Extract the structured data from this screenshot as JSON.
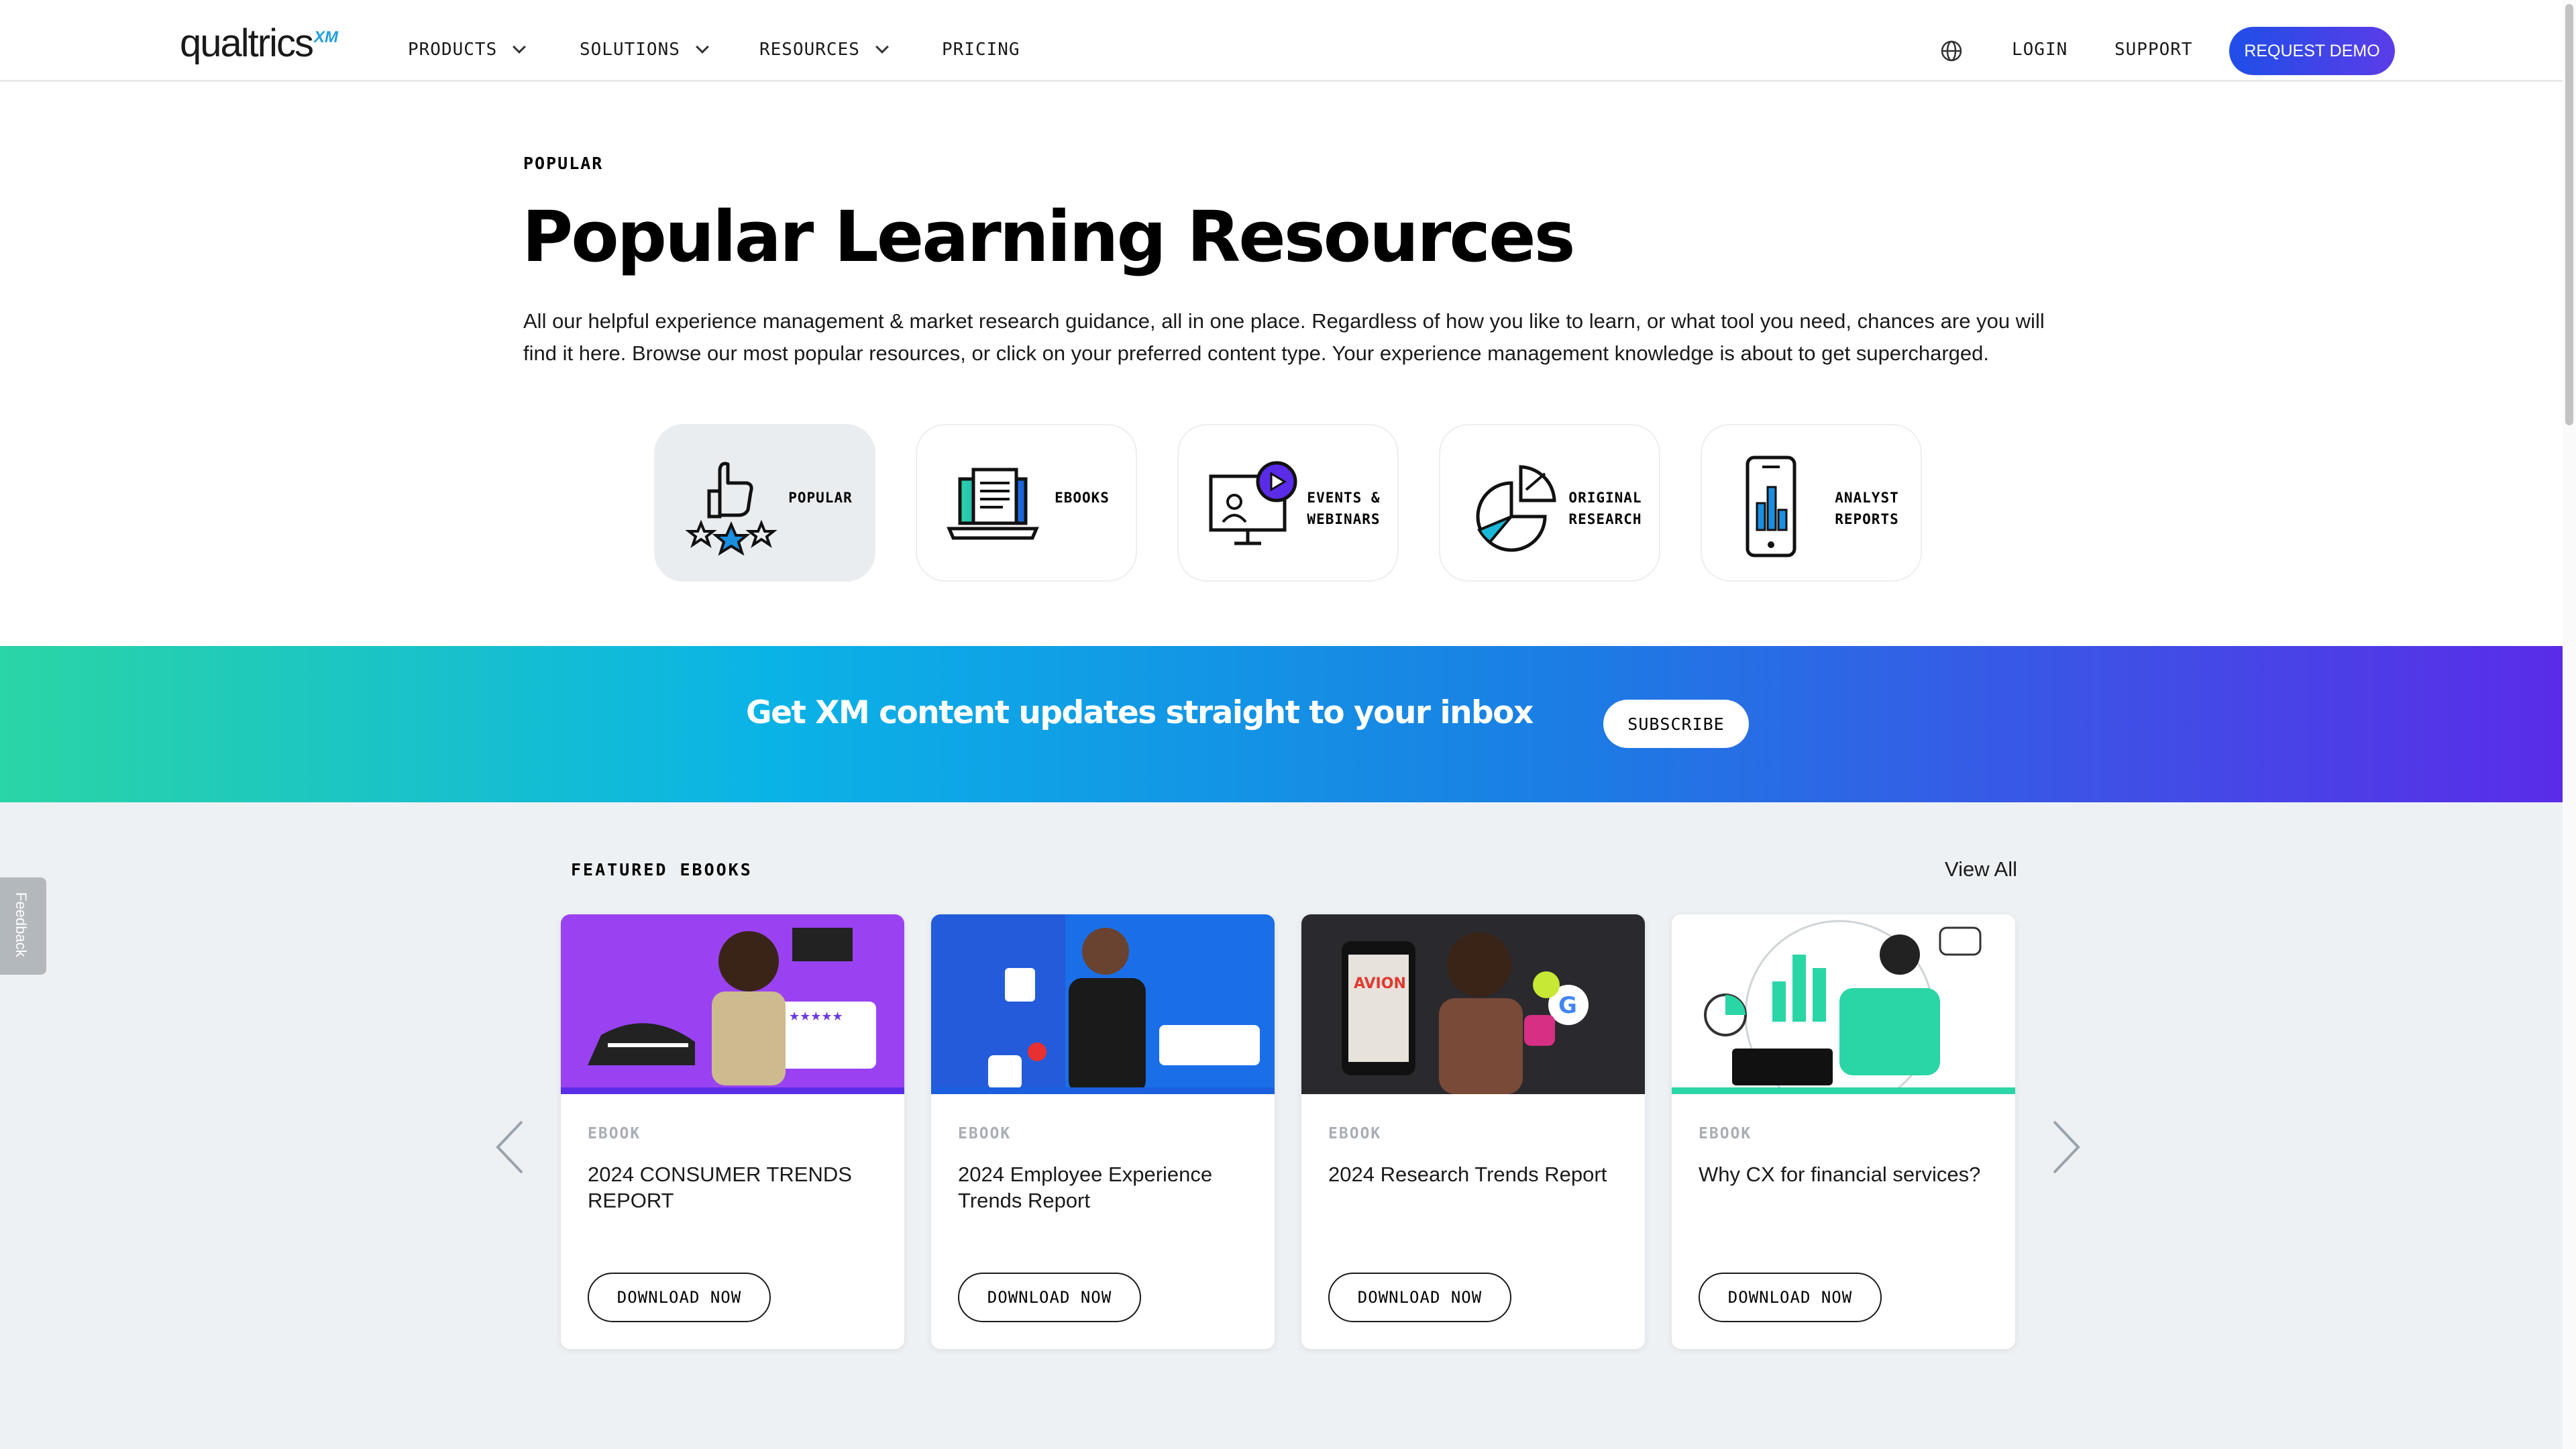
{
  "nav": {
    "logo": "qualtrics",
    "logo_badge": "XM",
    "items": [
      {
        "label": "PRODUCTS"
      },
      {
        "label": "SOLUTIONS"
      },
      {
        "label": "RESOURCES"
      },
      {
        "label": "PRICING"
      }
    ],
    "login": "LOGIN",
    "support": "SUPPORT",
    "demo": "REQUEST DEMO"
  },
  "hero": {
    "eyebrow": "POPULAR",
    "title": "Popular Learning Resources",
    "description": "All our helpful experience management & market research guidance, all in one place. Regardless of how you like to learn, or what tool you need, chances are you will find it here. Browse our most popular resources, or click on your preferred content type. Your experience management knowledge is about to get supercharged."
  },
  "categories": [
    {
      "line1": "POPULAR",
      "line2": "",
      "icon": "thumbs-up-stars-icon",
      "active": true
    },
    {
      "line1": "EBOOKS",
      "line2": "",
      "icon": "laptop-document-icon",
      "active": false
    },
    {
      "line1": "EVENTS &",
      "line2": "WEBINARS",
      "icon": "webinar-screen-icon",
      "active": false
    },
    {
      "line1": "ORIGINAL",
      "line2": "RESEARCH",
      "icon": "pie-chart-icon",
      "active": false
    },
    {
      "line1": "ANALYST",
      "line2": "REPORTS",
      "icon": "phone-bar-chart-icon",
      "active": false
    }
  ],
  "banner": {
    "text": "Get XM content updates straight to your inbox",
    "button": "SUBSCRIBE"
  },
  "featured": {
    "title": "FEATURED EBOOKS",
    "view_all": "View All",
    "cards": [
      {
        "kind": "EBOOK",
        "title": "2024 CONSUMER TRENDS REPORT",
        "button": "DOWNLOAD NOW"
      },
      {
        "kind": "EBOOK",
        "title": "2024 Employee Experience Trends Report",
        "button": "DOWNLOAD NOW"
      },
      {
        "kind": "EBOOK",
        "title": "2024 Research Trends Report",
        "button": "DOWNLOAD NOW"
      },
      {
        "kind": "EBOOK",
        "title": "Why CX for financial services?",
        "button": "DOWNLOAD NOW"
      }
    ]
  },
  "feedback": "Feedback",
  "colors": {
    "accent": "#1f4ee8",
    "banner_start": "#2ad5a6",
    "banner_end": "#5a2ce8",
    "featured_bg": "#edf1f3"
  }
}
